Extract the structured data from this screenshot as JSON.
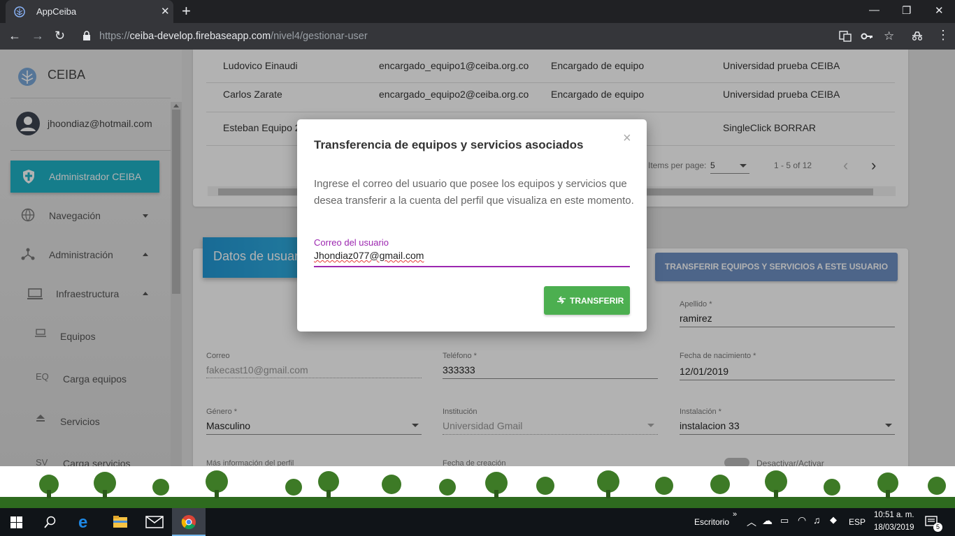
{
  "browser": {
    "tab_title": "AppCeiba",
    "url_scheme": "https://",
    "url_host": "ceiba-develop.firebaseapp.com",
    "url_path": "/nivel4/gestionar-user"
  },
  "sidebar": {
    "brand": "CEIBA",
    "user_email": "jhoondiaz@hotmail.com",
    "active_item": "Administrador CEIBA",
    "items": [
      {
        "label": "Navegación",
        "icon": "globe-icon"
      },
      {
        "label": "Administración",
        "icon": "hierarchy-icon"
      },
      {
        "label": "Infraestructura",
        "icon": "laptop-icon"
      },
      {
        "label": "Equipos",
        "icon": "laptop-small-icon"
      },
      {
        "label": "Carga equipos",
        "icon": "EQ"
      },
      {
        "label": "Servicios",
        "icon": "eject-icon"
      },
      {
        "label": "Carga servicios",
        "icon": "SV"
      }
    ]
  },
  "table": {
    "rows": [
      {
        "name": "Ludovico Einaudi",
        "email": "encargado_equipo1@ceiba.org.co",
        "role": "Encargado de equipo",
        "org": "Universidad prueba CEIBA"
      },
      {
        "name": "Carlos Zarate",
        "email": "encargado_equipo2@ceiba.org.co",
        "role": "Encargado de equipo",
        "org": "Universidad prueba CEIBA"
      },
      {
        "name": "Esteban Equipo 2",
        "email": "",
        "role": "",
        "org": "SingleClick BORRAR"
      }
    ],
    "items_per_page_label": "Items per page:",
    "items_per_page": "5",
    "range": "1 - 5 of 12"
  },
  "profile": {
    "header": "Datos de usuar",
    "transfer_button": "TRANSFERIR EQUIPOS Y SERVICIOS A ESTE USUARIO",
    "fields": {
      "apellido_label": "Apellido *",
      "apellido": "ramirez",
      "correo_label": "Correo",
      "correo": "fakecast10@gmail.com",
      "telefono_label": "Teléfono *",
      "telefono": "333333",
      "nacimiento_label": "Fecha de nacimiento *",
      "nacimiento": "12/01/2019",
      "genero_label": "Género *",
      "genero": "Masculino",
      "institucion_label": "Institución",
      "institucion": "Universidad Gmail",
      "instalacion_label": "Instalación *",
      "instalacion": "instalacion 33",
      "mas_info_label": "Más información del perfil",
      "creacion_label": "Fecha de creación",
      "toggle_label": "Desactivar/Activar"
    }
  },
  "modal": {
    "title": "Transferencia de equipos y servicios asociados",
    "body": "Ingrese el correo del usuario que posee los equipos y servicios que desea transferir a la cuenta del perfil que visualiza en este momento.",
    "field_label": "Correo del usuario",
    "field_value": "Jhondiaz077@gmail.com",
    "button": "TRANSFERIR"
  },
  "taskbar": {
    "desktop_label": "Escritorio",
    "language": "ESP",
    "time": "10:51 a. m.",
    "date": "18/03/2019",
    "notifications": "5"
  },
  "colors": {
    "accent": "#1fb3c8",
    "purple": "#9c27b0",
    "green": "#4caf50",
    "blue_button": "#6f91c4"
  }
}
